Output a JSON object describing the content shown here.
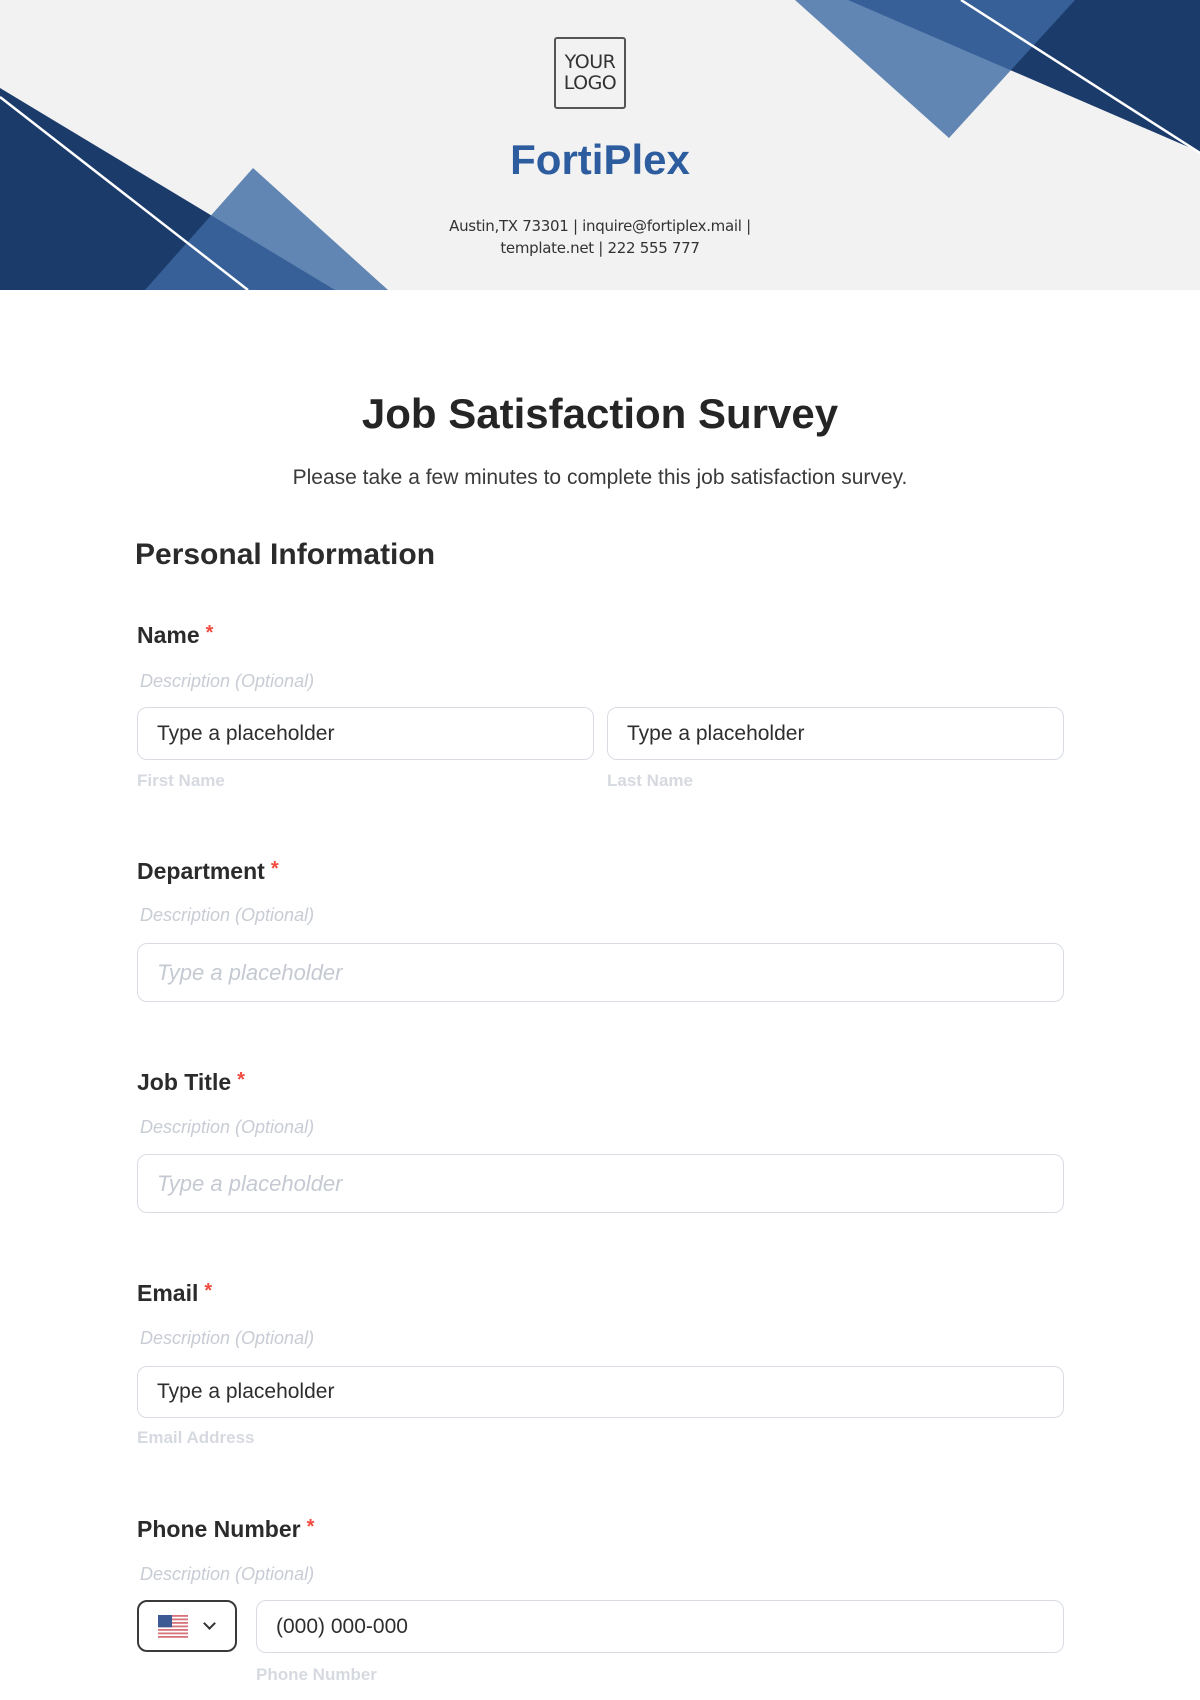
{
  "header": {
    "logo_line1": "YOUR",
    "logo_line2": "LOGO",
    "brand_name": "FortiPlex",
    "contact_line1": "Austin,TX 73301 | inquire@fortiplex.mail |",
    "contact_line2": "template.net | 222 555 777",
    "colors": {
      "dark": "#1b3b6b",
      "mid": "#225088",
      "light": "#5f82ad",
      "brand": "#2d5d9f"
    }
  },
  "form": {
    "title": "Job Satisfaction Survey",
    "subtitle": "Please take a few minutes to complete this job satisfaction survey.",
    "section_heading": "Personal Information",
    "required_mark": "*",
    "fields": {
      "name": {
        "label": "Name",
        "description": "Description (Optional)",
        "first": {
          "value": "Type a placeholder",
          "caption": "First Name"
        },
        "last": {
          "value": "Type a placeholder",
          "caption": "Last Name"
        }
      },
      "department": {
        "label": "Department",
        "description": "Description (Optional)",
        "placeholder": "Type a placeholder"
      },
      "job_title": {
        "label": "Job Title",
        "description": "Description (Optional)",
        "placeholder": "Type a placeholder"
      },
      "email": {
        "label": "Email",
        "description": "Description (Optional)",
        "value": "Type a placeholder",
        "caption": "Email Address"
      },
      "phone": {
        "label": "Phone Number",
        "description": "Description (Optional)",
        "country_icon": "us-flag-icon",
        "value": "(000) 000-000",
        "caption": "Phone Number"
      }
    }
  }
}
